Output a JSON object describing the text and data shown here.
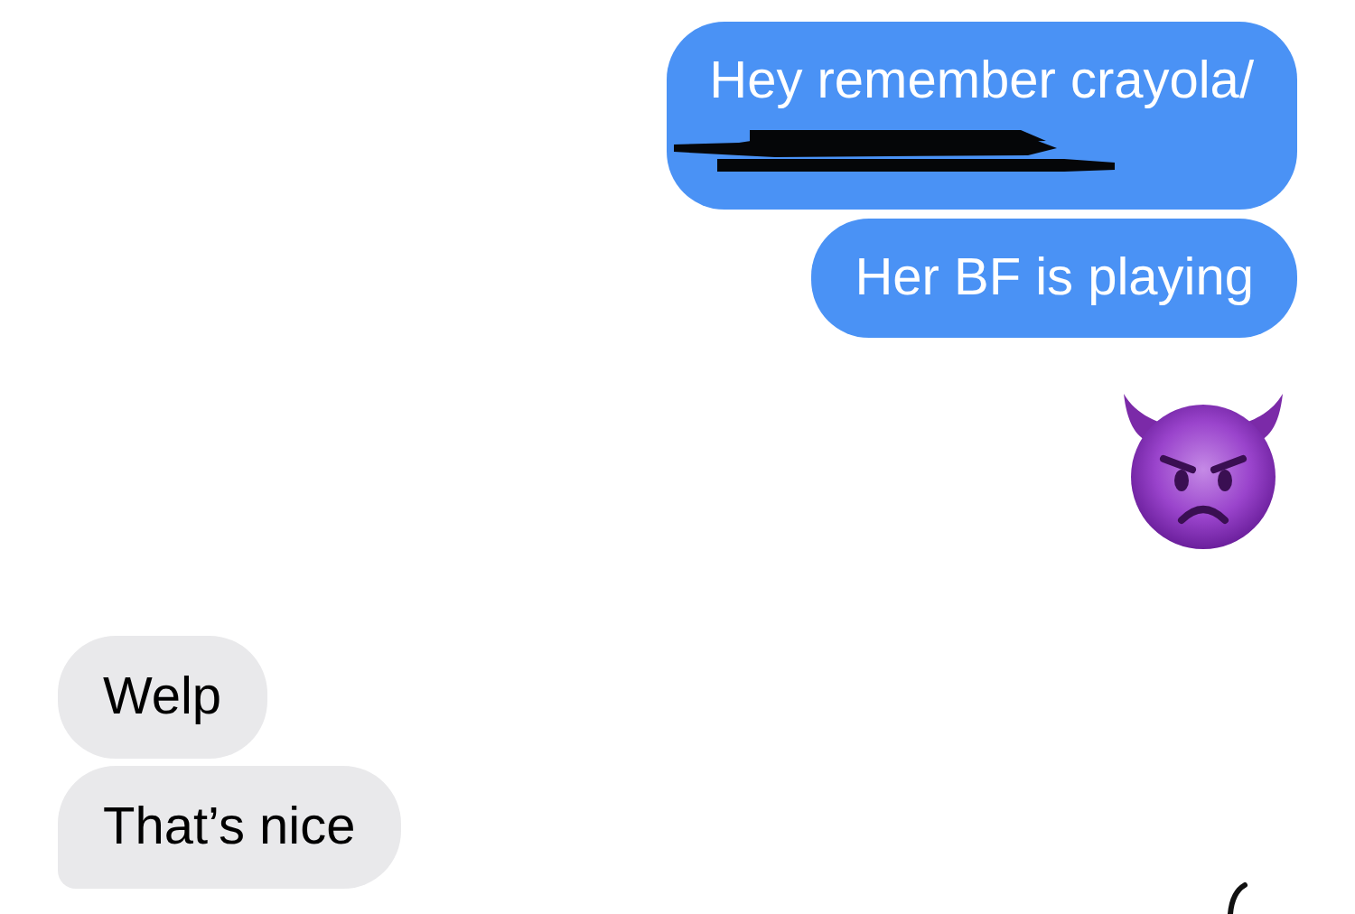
{
  "messages": [
    {
      "kind": "sent",
      "text": "Hey remember crayola/",
      "redacted_line": true
    },
    {
      "kind": "sent",
      "text": "Her BF is playing",
      "redacted_line": false
    },
    {
      "kind": "emoji"
    },
    {
      "kind": "received",
      "text": "Welp",
      "tail": false
    },
    {
      "kind": "received",
      "text": "That’s nice",
      "tail": true
    }
  ]
}
